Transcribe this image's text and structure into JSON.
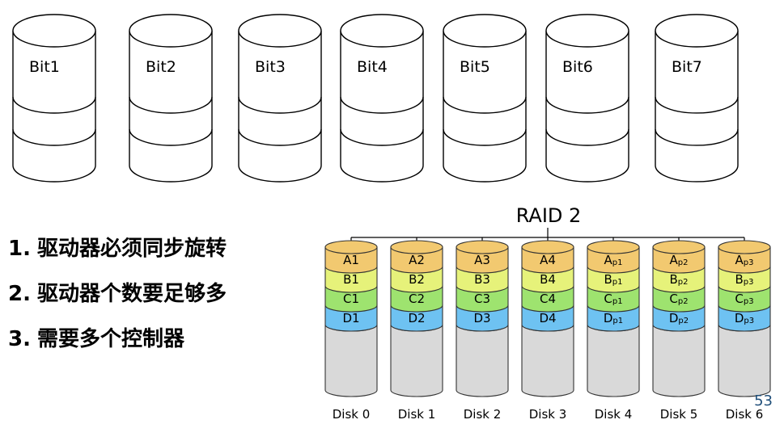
{
  "bit_drives": [
    "Bit1",
    "Bit2",
    "Bit3",
    "Bit4",
    "Bit5",
    "Bit6",
    "Bit7"
  ],
  "requirements": [
    {
      "num": "1.",
      "text": "驱动器必须同步旋转"
    },
    {
      "num": "2.",
      "text": "驱动器个数要足够多"
    },
    {
      "num": "3.",
      "text": "需要多个控制器"
    }
  ],
  "raid": {
    "title": "RAID 2",
    "disks": [
      {
        "label": "Disk 0",
        "blocks": [
          {
            "t": "A1"
          },
          {
            "t": "B1"
          },
          {
            "t": "C1"
          },
          {
            "t": "D1"
          }
        ]
      },
      {
        "label": "Disk 1",
        "blocks": [
          {
            "t": "A2"
          },
          {
            "t": "B2"
          },
          {
            "t": "C2"
          },
          {
            "t": "D2"
          }
        ]
      },
      {
        "label": "Disk 2",
        "blocks": [
          {
            "t": "A3"
          },
          {
            "t": "B3"
          },
          {
            "t": "C3"
          },
          {
            "t": "D3"
          }
        ]
      },
      {
        "label": "Disk 3",
        "blocks": [
          {
            "t": "A4"
          },
          {
            "t": "B4"
          },
          {
            "t": "C4"
          },
          {
            "t": "D4"
          }
        ]
      },
      {
        "label": "Disk 4",
        "blocks": [
          {
            "t": "A",
            "s": "p1"
          },
          {
            "t": "B",
            "s": "p1"
          },
          {
            "t": "C",
            "s": "p1"
          },
          {
            "t": "D",
            "s": "p1"
          }
        ]
      },
      {
        "label": "Disk 5",
        "blocks": [
          {
            "t": "A",
            "s": "p2"
          },
          {
            "t": "B",
            "s": "p2"
          },
          {
            "t": "C",
            "s": "p2"
          },
          {
            "t": "D",
            "s": "p2"
          }
        ]
      },
      {
        "label": "Disk 6",
        "blocks": [
          {
            "t": "A",
            "s": "p3"
          },
          {
            "t": "B",
            "s": "p3"
          },
          {
            "t": "C",
            "s": "p3"
          },
          {
            "t": "D",
            "s": "p3"
          }
        ]
      }
    ],
    "colors": {
      "A": "#f2c970",
      "B": "#e6f27a",
      "C": "#9ee36f",
      "D": "#6ec2f2",
      "body": "#d9d9d9"
    }
  },
  "page_number": "53"
}
